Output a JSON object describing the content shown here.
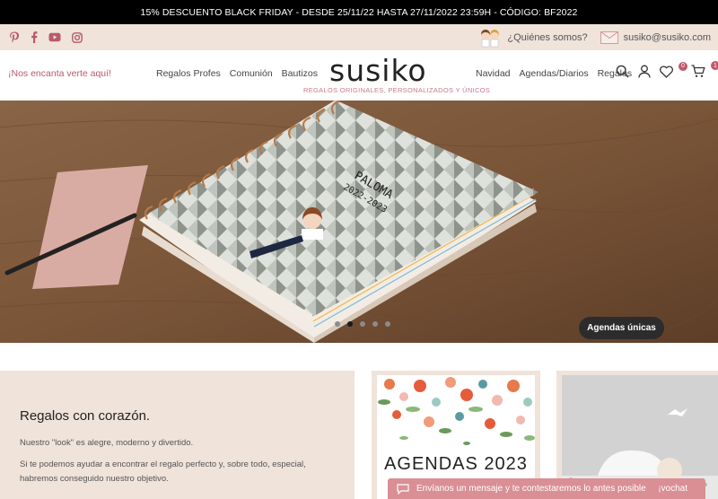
{
  "promo_bar": {
    "text": "15% DESCUENTO BLACK FRIDAY - DESDE 25/11/22 HASTA 27/11/2022 23:59H - CÓDIGO: BF2022"
  },
  "topbar": {
    "social_icons": [
      "pinterest-icon",
      "facebook-icon",
      "youtube-icon",
      "instagram-icon"
    ],
    "about_label": "¿Quiénes somos?",
    "email": "susiko@susiko.com"
  },
  "header": {
    "tagline": "¡Nos encanta verte aquí!",
    "nav_left": [
      "Regalos Profes",
      "Comunión",
      "Bautizos"
    ],
    "logo": "susiko",
    "logo_subtitle": "REGALOS ORIGINALES, PERSONALIZADOS Y ÚNICOS",
    "nav_right": [
      "Navidad",
      "Agendas/Diarios",
      "Regalos"
    ],
    "wishlist_count": "0",
    "cart_count": "1"
  },
  "hero": {
    "cta_label": "Agendas únicas",
    "notebook_name": "PALOMA",
    "notebook_year": "2022-2023",
    "slides": 5,
    "active_slide": 2
  },
  "intro": {
    "heading": "Regalos con corazón.",
    "p1": "Nuestro \"look\" es alegre, moderno y divertido.",
    "p2": "Si te podemos ayudar a encontrar el regalo perfecto y, sobre todo, especial, habremos conseguido nuestro objetivo."
  },
  "cards": {
    "agendas_title": "AGENDAS 2023"
  },
  "chat": {
    "text": "Envíanos un mensaje y te contestaremos lo antes posible",
    "trailing": "¡vochat"
  },
  "colors": {
    "accent": "#b75a6a",
    "beige": "#efe3da",
    "chat": "#d98f94"
  }
}
